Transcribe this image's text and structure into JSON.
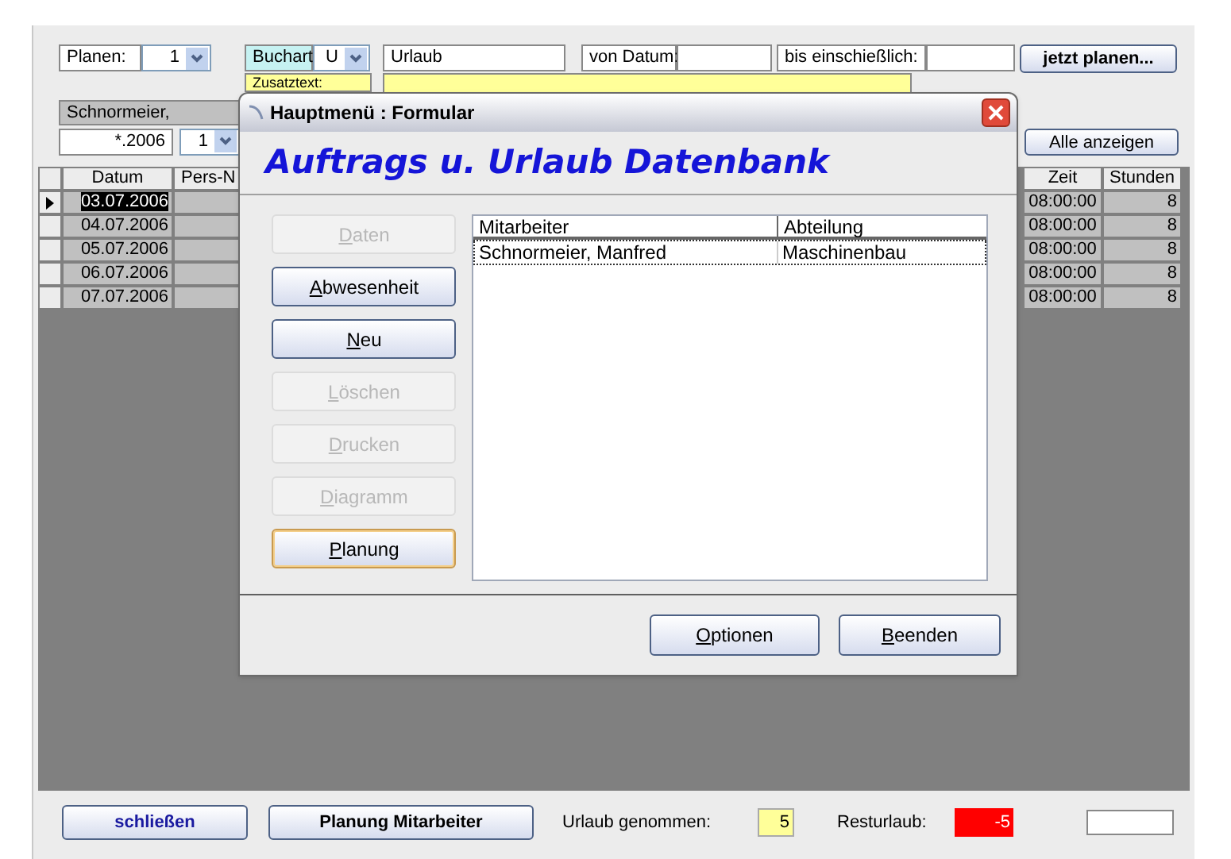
{
  "filter": {
    "planen_label": "Planen:",
    "planen_value": "1",
    "buchart_label": "Buchart:",
    "buchart_value": "U",
    "buchart_text": "Urlaub",
    "von_label": "von Datum:",
    "bis_label": "bis einschießlich:",
    "plan_button": "jetzt planen...",
    "zusatz_label": "Zusatztext:"
  },
  "employee": {
    "name": "Schnormeier,",
    "year": "*.2006",
    "number": "1"
  },
  "show_all_button": "Alle anzeigen",
  "grid": {
    "left_columns": [
      "Datum",
      "Pers-N"
    ],
    "right_columns": [
      "Zeit",
      "Stunden"
    ],
    "rows": [
      {
        "datum": "03.07.2006",
        "zeit": "08:00:00",
        "stunden": "8",
        "selected": true
      },
      {
        "datum": "04.07.2006",
        "zeit": "08:00:00",
        "stunden": "8",
        "selected": false
      },
      {
        "datum": "05.07.2006",
        "zeit": "08:00:00",
        "stunden": "8",
        "selected": false
      },
      {
        "datum": "06.07.2006",
        "zeit": "08:00:00",
        "stunden": "8",
        "selected": false
      },
      {
        "datum": "07.07.2006",
        "zeit": "08:00:00",
        "stunden": "8",
        "selected": false
      }
    ]
  },
  "dialog": {
    "title": "Hauptmenü : Formular",
    "heading": "Auftrags u. Urlaub Datenbank",
    "buttons": [
      {
        "label": "Daten",
        "disabled": true,
        "selected": false
      },
      {
        "label": "Abwesenheit",
        "disabled": false,
        "selected": false
      },
      {
        "label": "Neu",
        "disabled": false,
        "selected": false
      },
      {
        "label": "Löschen",
        "disabled": true,
        "selected": false
      },
      {
        "label": "Drucken",
        "disabled": true,
        "selected": false
      },
      {
        "label": "Diagramm",
        "disabled": true,
        "selected": false
      },
      {
        "label": "Planung",
        "disabled": false,
        "selected": true
      }
    ],
    "list": {
      "columns": [
        "Mitarbeiter",
        "Abteilung"
      ],
      "rows": [
        {
          "cells": [
            "Schnormeier, Manfred",
            "Maschinenbau"
          ],
          "selected": true
        }
      ]
    },
    "footer_buttons": [
      "Optionen",
      "Beenden"
    ]
  },
  "footer": {
    "close_button": "schließen",
    "plan_button": "Planung Mitarbeiter",
    "taken_label": "Urlaub genommen:",
    "taken_value": "5",
    "rest_label": "Resturlaub:",
    "rest_value": "-5"
  }
}
